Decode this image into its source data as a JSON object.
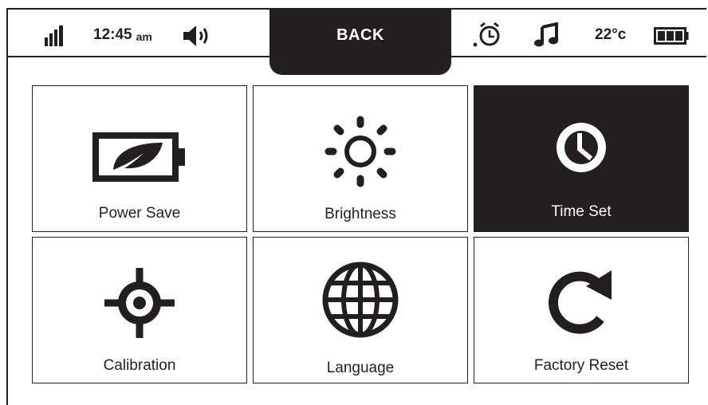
{
  "status_bar": {
    "signal_icon": "signal-bars-icon",
    "time": "12:45",
    "ampm": "am",
    "volume_icon": "speaker-volume-icon",
    "alarm_icon": "alarm-clock-icon",
    "music_icon": "music-note-icon",
    "temperature": "22°c",
    "battery_icon": "battery-full-icon"
  },
  "back_button": {
    "label": "BACK"
  },
  "tiles": [
    {
      "label": "Power Save",
      "icon": "battery-leaf-icon",
      "active": false
    },
    {
      "label": "Brightness",
      "icon": "sun-icon",
      "active": false
    },
    {
      "label": "Time Set",
      "icon": "clock-icon",
      "active": true
    },
    {
      "label": "Calibration",
      "icon": "crosshair-icon",
      "active": false
    },
    {
      "label": "Language",
      "icon": "globe-icon",
      "active": false
    },
    {
      "label": "Factory Reset",
      "icon": "rotate-arrow-icon",
      "active": false
    }
  ],
  "colors": {
    "ink": "#231f20",
    "background": "#ffffff",
    "active_text": "#ffffff"
  }
}
